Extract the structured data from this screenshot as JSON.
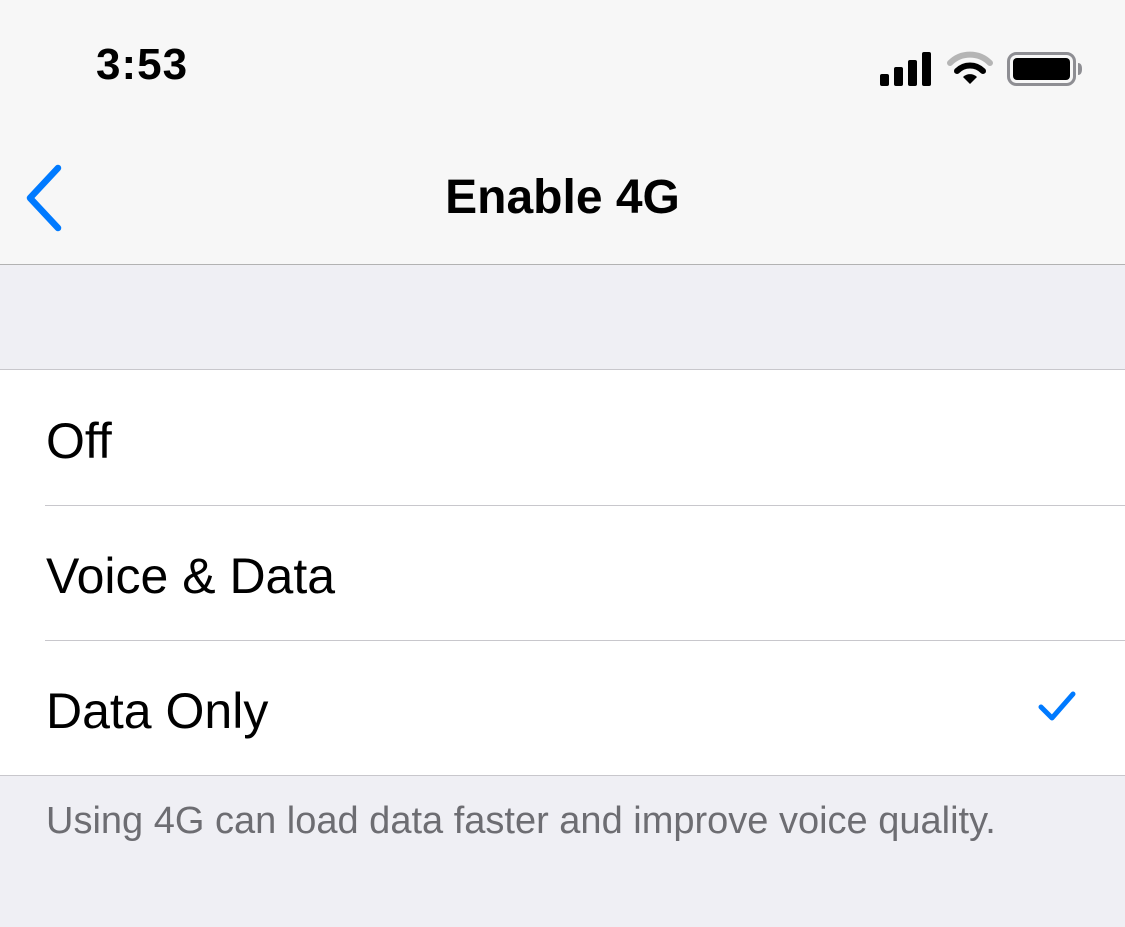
{
  "status_bar": {
    "time": "3:53",
    "icons": [
      "signal-icon",
      "wifi-icon",
      "battery-icon"
    ]
  },
  "nav": {
    "back_icon": "chevron-left-icon",
    "title": "Enable 4G"
  },
  "options": [
    {
      "label": "Off",
      "selected": false
    },
    {
      "label": "Voice & Data",
      "selected": false
    },
    {
      "label": "Data Only",
      "selected": true
    }
  ],
  "footer": {
    "note": "Using 4G can load data faster and improve voice quality."
  },
  "colors": {
    "accent": "#007aff",
    "background": "#efeff4",
    "bar": "#f7f7f7",
    "footer_text": "#6d6d72"
  }
}
